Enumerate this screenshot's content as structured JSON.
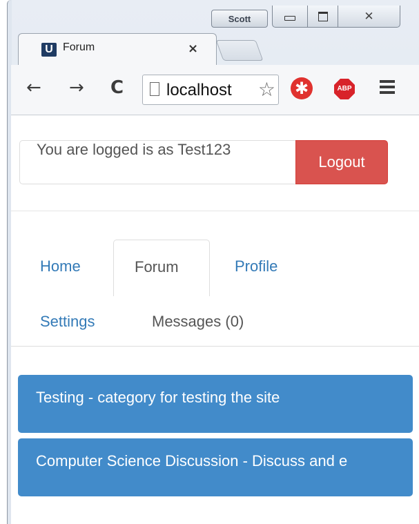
{
  "window": {
    "profile_name": "Scott",
    "controls": [
      "minimize",
      "maximize",
      "close"
    ],
    "close_glyph": "✕"
  },
  "tab": {
    "favicon_letter": "U",
    "title": "Forum",
    "close_glyph": "×"
  },
  "toolbar": {
    "back_glyph": "←",
    "forward_glyph": "→",
    "reload_glyph": "C",
    "url": "localhost",
    "star_glyph": "☆",
    "extension1_glyph": "✱",
    "extension2_label": "ABP"
  },
  "page": {
    "login_status": "You are logged is as Test123",
    "logout_label": "Logout",
    "nav": {
      "home": "Home",
      "forum": "Forum",
      "profile": "Profile",
      "settings": "Settings",
      "messages": "Messages (0)"
    },
    "categories": [
      {
        "label": "Testing - category for testing the site"
      },
      {
        "label": "Computer Science Discussion - Discuss and e"
      }
    ],
    "colors": {
      "category_bg": "#428bca",
      "logout_bg": "#d9534f",
      "link": "#337ab7"
    }
  }
}
